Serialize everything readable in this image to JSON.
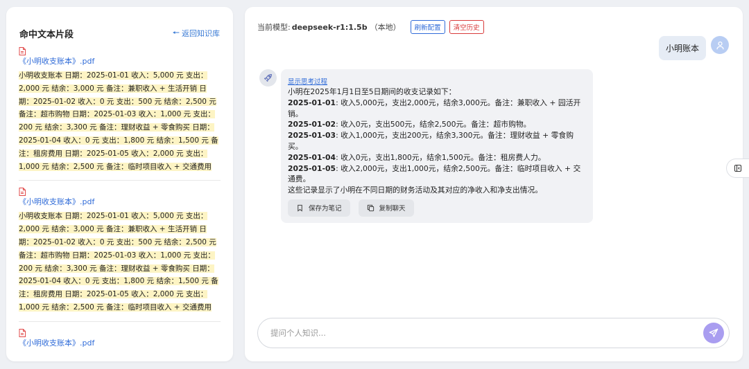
{
  "left_panel": {
    "title": "命中文本片段",
    "back_label": "返回知识库",
    "hits": [
      {
        "doc": "《小明收支账本》.pdf",
        "lines": [
          "小明收支账本 日期：2025-01-01 收入：5,000 元 支出：",
          "2,000 元 结余：3,000 元 备注：兼职收入 + 生活开销 日",
          "期：2025-01-02 收入：0 元 支出：500 元 结余：2,500 元",
          "备注：超市购物 日期：2025-01-03 收入：1,000 元 支出：",
          "200 元 结余：3,300 元 备注：理财收益 + 零食购买 日期：",
          "2025-01-04 收入：0 元 支出：1,800 元 结余：1,500 元 备",
          "注：租房费用 日期：2025-01-05 收入：2,000 元 支出：",
          "1,000 元 结余：2,500 元 备注：临时项目收入 + 交通费用"
        ]
      },
      {
        "doc": "《小明收支账本》.pdf",
        "lines": [
          "小明收支账本 日期：2025-01-01 收入：5,000 元 支出：",
          "2,000 元 结余：3,000 元 备注：兼职收入 + 生活开销 日",
          "期：2025-01-02 收入：0 元 支出：500 元 结余：2,500 元",
          "备注：超市购物 日期：2025-01-03 收入：1,000 元 支出：",
          "200 元 结余：3,300 元 备注：理财收益 + 零食购买 日期：",
          "2025-01-04 收入：0 元 支出：1,800 元 结余：1,500 元 备",
          "注：租房费用 日期：2025-01-05 收入：2,000 元 支出：",
          "1,000 元 结余：2,500 元 备注：临时项目收入 + 交通费用"
        ]
      },
      {
        "doc": "《小明收支账本》.pdf",
        "lines": []
      }
    ]
  },
  "chat": {
    "model_label": "当前模型:",
    "model_name": "deepseek-r1:1.5b",
    "model_suffix": "（本地）",
    "refresh_label": "刷新配置",
    "clear_label": "清空历史",
    "user_message": "小明账本",
    "think_toggle": "显示思考过程",
    "answer": {
      "intro": "小明在2025年1月1日至5日期间的收支记录如下：",
      "entries": [
        {
          "date": "2025-01-01",
          "text": ": 收入5,000元，支出2,000元，结余3,000元。备注：兼职收入 + 园活开销。"
        },
        {
          "date": "2025-01-02",
          "text": ": 收入0元，支出500元，结余2,500元。备注：超市购物。"
        },
        {
          "date": "2025-01-03",
          "text": ": 收入1,000元，支出200元，结余3,300元。备注：理财收益 + 零食购买。"
        },
        {
          "date": "2025-01-04",
          "text": ": 收入0元，支出1,800元，结余1,500元。备注：租房费人力。"
        },
        {
          "date": "2025-01-05",
          "text": ": 收入2,000元，支出1,000元，结余2,500元。备注：临时项目收入 + 交通费。"
        }
      ],
      "outro": "这些记录显示了小明在不同日期的财务活动及其对应的净收入和净支出情况。"
    },
    "save_note_label": "保存为笔记",
    "copy_chat_label": "复制聊天",
    "input_placeholder": "提问个人知识...",
    "input_value": ""
  },
  "colors": {
    "accent_blue": "#2f6bd8",
    "danger_red": "#d83a3a",
    "highlight": "#fdf4c4",
    "send_button": "#a99df0"
  },
  "icons": {
    "back": "arrow-left-icon",
    "pdf": "pdf-file-icon",
    "user": "user-icon",
    "bot": "rocket-icon",
    "save": "bookmark-icon",
    "copy": "copy-icon",
    "send": "send-icon",
    "toggle": "sidebar-toggle-icon"
  }
}
